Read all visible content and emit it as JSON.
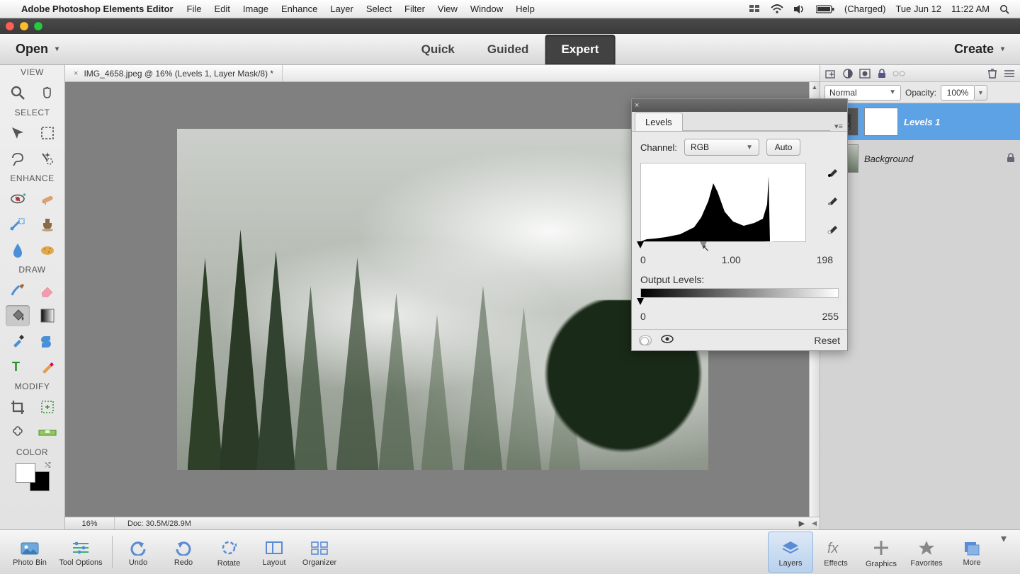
{
  "menubar": {
    "app_name": "Adobe Photoshop Elements Editor",
    "items": [
      "File",
      "Edit",
      "Image",
      "Enhance",
      "Layer",
      "Select",
      "Filter",
      "View",
      "Window",
      "Help"
    ],
    "battery": "(Charged)",
    "date": "Tue Jun 12",
    "time": "11:22 AM"
  },
  "topbar": {
    "open": "Open",
    "modes": [
      "Quick",
      "Guided",
      "Expert"
    ],
    "active_mode": 2,
    "create": "Create"
  },
  "toolbox": {
    "sections": {
      "view": "VIEW",
      "select": "SELECT",
      "enhance": "ENHANCE",
      "draw": "DRAW",
      "modify": "MODIFY",
      "color": "COLOR"
    }
  },
  "document": {
    "tab_title": "IMG_4658.jpeg @ 16% (Levels 1, Layer Mask/8) *",
    "zoom": "16%",
    "doc_info": "Doc: 30.5M/28.9M"
  },
  "levels": {
    "title": "Levels",
    "channel_label": "Channel:",
    "channel_value": "RGB",
    "auto": "Auto",
    "input": {
      "black": "0",
      "gamma": "1.00",
      "white": "198"
    },
    "output_label": "Output Levels:",
    "output": {
      "black": "0",
      "white": "255"
    },
    "reset": "Reset"
  },
  "layers_panel": {
    "blend_mode": "Normal",
    "opacity_label": "Opacity:",
    "opacity_value": "100%",
    "layers": [
      {
        "name": "Levels 1",
        "selected": true,
        "has_mask": true,
        "is_adjustment": true
      },
      {
        "name": "Background",
        "selected": false,
        "locked": true
      }
    ]
  },
  "bottombar": {
    "left": [
      "Photo Bin",
      "Tool Options"
    ],
    "mid": [
      "Undo",
      "Redo",
      "Rotate",
      "Layout",
      "Organizer"
    ],
    "right": [
      "Layers",
      "Effects",
      "Graphics",
      "Favorites",
      "More"
    ],
    "active_right": 0
  }
}
